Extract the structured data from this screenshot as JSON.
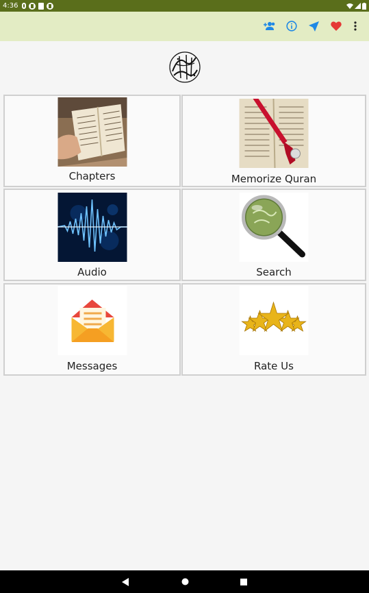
{
  "status_bar": {
    "time": "4:36",
    "left_icons": [
      "mic-icon",
      "app-notification-icon",
      "sd-card-icon",
      "app-notification-icon"
    ],
    "right_icons": [
      "wifi-icon",
      "cell-signal-icon",
      "battery-icon"
    ]
  },
  "app_bar": {
    "actions": [
      "group-add-icon",
      "info-icon",
      "send-icon",
      "heart-icon",
      "more-vert-icon"
    ],
    "colors": {
      "background": "#e3ecc4",
      "accent": "#1e88e5",
      "heart": "#e53935"
    }
  },
  "logo": {
    "name": "quran-calligraphy-logo"
  },
  "tiles": [
    {
      "label": "Chapters",
      "image": "open-quran-book-image"
    },
    {
      "label": "Memorize Quran",
      "image": "quran-bookmark-image"
    },
    {
      "label": "Audio",
      "image": "audio-waveform-image"
    },
    {
      "label": "Search",
      "image": "magnifying-glass-image"
    },
    {
      "label": "Messages",
      "image": "envelope-image"
    },
    {
      "label": "Rate Us",
      "image": "stars-image"
    }
  ],
  "nav_bar": {
    "buttons": [
      "back-icon",
      "home-icon",
      "recents-icon"
    ]
  }
}
